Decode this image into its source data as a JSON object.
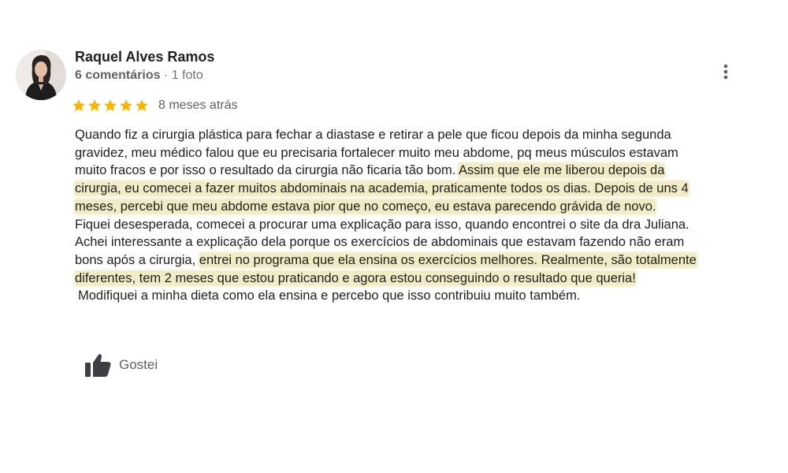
{
  "review": {
    "author": {
      "name": "Raquel Alves Ramos",
      "meta_count": "6 comentários",
      "meta_rest": " · 1 foto",
      "avatar_icon": "avatar-photo-woman"
    },
    "more_icon": "more-vert-icon",
    "rating": {
      "stars": 5,
      "max": 5,
      "color": "#f9b403"
    },
    "date": "8 meses atrás",
    "highlight_color": "#e6dc96",
    "lines": [
      [
        {
          "text": "Quando fiz a cirurgia plástica para fechar a diastase e retirar a pele que ficou depois da minha segunda",
          "hl": false
        }
      ],
      [
        {
          "text": "gravidez, meu médico falou que eu precisaria fortalecer muito meu abdome, pq meus músculos estavam",
          "hl": false
        }
      ],
      [
        {
          "text": "muito fracos e por isso o resultado da cirurgia não ficaria tão bom. ",
          "hl": false
        },
        {
          "text": "Assim que ele me liberou depois da",
          "hl": true
        }
      ],
      [
        {
          "text": "cirurgia, eu comecei a fazer muitos abdominais na academia, praticamente todos os dias. Depois de uns 4",
          "hl": true
        }
      ],
      [
        {
          "text": "meses, percebi que meu abdome estava pior que no começo, eu estava parecendo grávida de novo.",
          "hl": true
        }
      ],
      [
        {
          "text": "Fiquei desesperada, comecei a procurar uma explicação para isso, quando encontrei o site da dra Juliana.",
          "hl": false
        }
      ],
      [
        {
          "text": "Achei interessante a explicação dela porque os exercícios de abdominais que estavam fazendo não eram",
          "hl": false
        }
      ],
      [
        {
          "text": "bons após a cirurgia, ",
          "hl": false
        },
        {
          "text": "entrei no programa que ela ensina os exercícios melhores. Realmente, são totalmente",
          "hl": true
        }
      ],
      [
        {
          "text": "diferentes, tem 2 meses que estou praticando e agora estou conseguindo o resultado que queria!",
          "hl": true
        }
      ],
      [
        {
          "text": "Modifiquei a minha dieta como ela ensina e percebo que isso contribuiu muito também.",
          "hl": false,
          "indent": true
        }
      ]
    ],
    "like": {
      "label": "Gostei",
      "icon": "thumbs-up-icon"
    }
  }
}
